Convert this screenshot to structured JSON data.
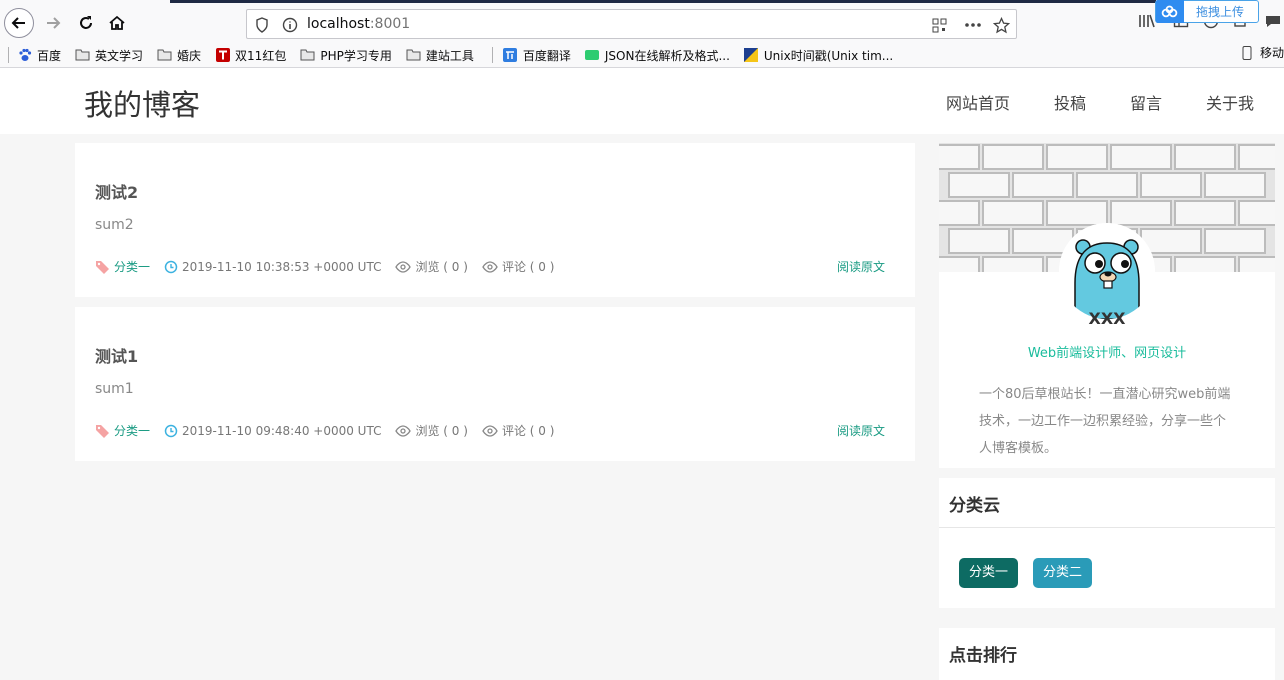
{
  "browser": {
    "url_host": "localhost",
    "url_port": ":8001",
    "upload_label": "拖拽上传",
    "bookmarks": [
      "百度",
      "英文学习",
      "婚庆",
      "双11红包",
      "PHP学习专用",
      "建站工具",
      "百度翻译",
      "JSON在线解析及格式...",
      "Unix时间戳(Unix tim..."
    ],
    "mobile_label": "移动"
  },
  "site": {
    "logo": "我的博客",
    "nav": [
      "网站首页",
      "投稿",
      "留言",
      "关于我"
    ]
  },
  "articles": [
    {
      "title": "测试2",
      "summary": "sum2",
      "category": "分类一",
      "time": "2019-11-10 10:38:53 +0000 UTC",
      "views": "浏览 ( 0 )",
      "comments": "评论 ( 0 )",
      "read_more": "阅读原文"
    },
    {
      "title": "测试1",
      "summary": "sum1",
      "category": "分类一",
      "time": "2019-11-10 09:48:40 +0000 UTC",
      "views": "浏览 ( 0 )",
      "comments": "评论 ( 0 )",
      "read_more": "阅读原文"
    }
  ],
  "sidebar": {
    "profile": {
      "name": "XXX",
      "role": "Web前端设计师、网页设计",
      "description": "一个80后草根站长！一直潜心研究web前端技术，一边工作一边积累经验，分享一些个人博客模板。"
    },
    "category_cloud": {
      "title": "分类云",
      "tags": [
        {
          "label": "分类一",
          "color": "#0d6b63"
        },
        {
          "label": "分类二",
          "color": "#2a9bb8"
        }
      ]
    },
    "ranking": {
      "title": "点击排行"
    }
  },
  "colors": {
    "accent": "#1abc9c",
    "link_green": "#1a9b83"
  }
}
